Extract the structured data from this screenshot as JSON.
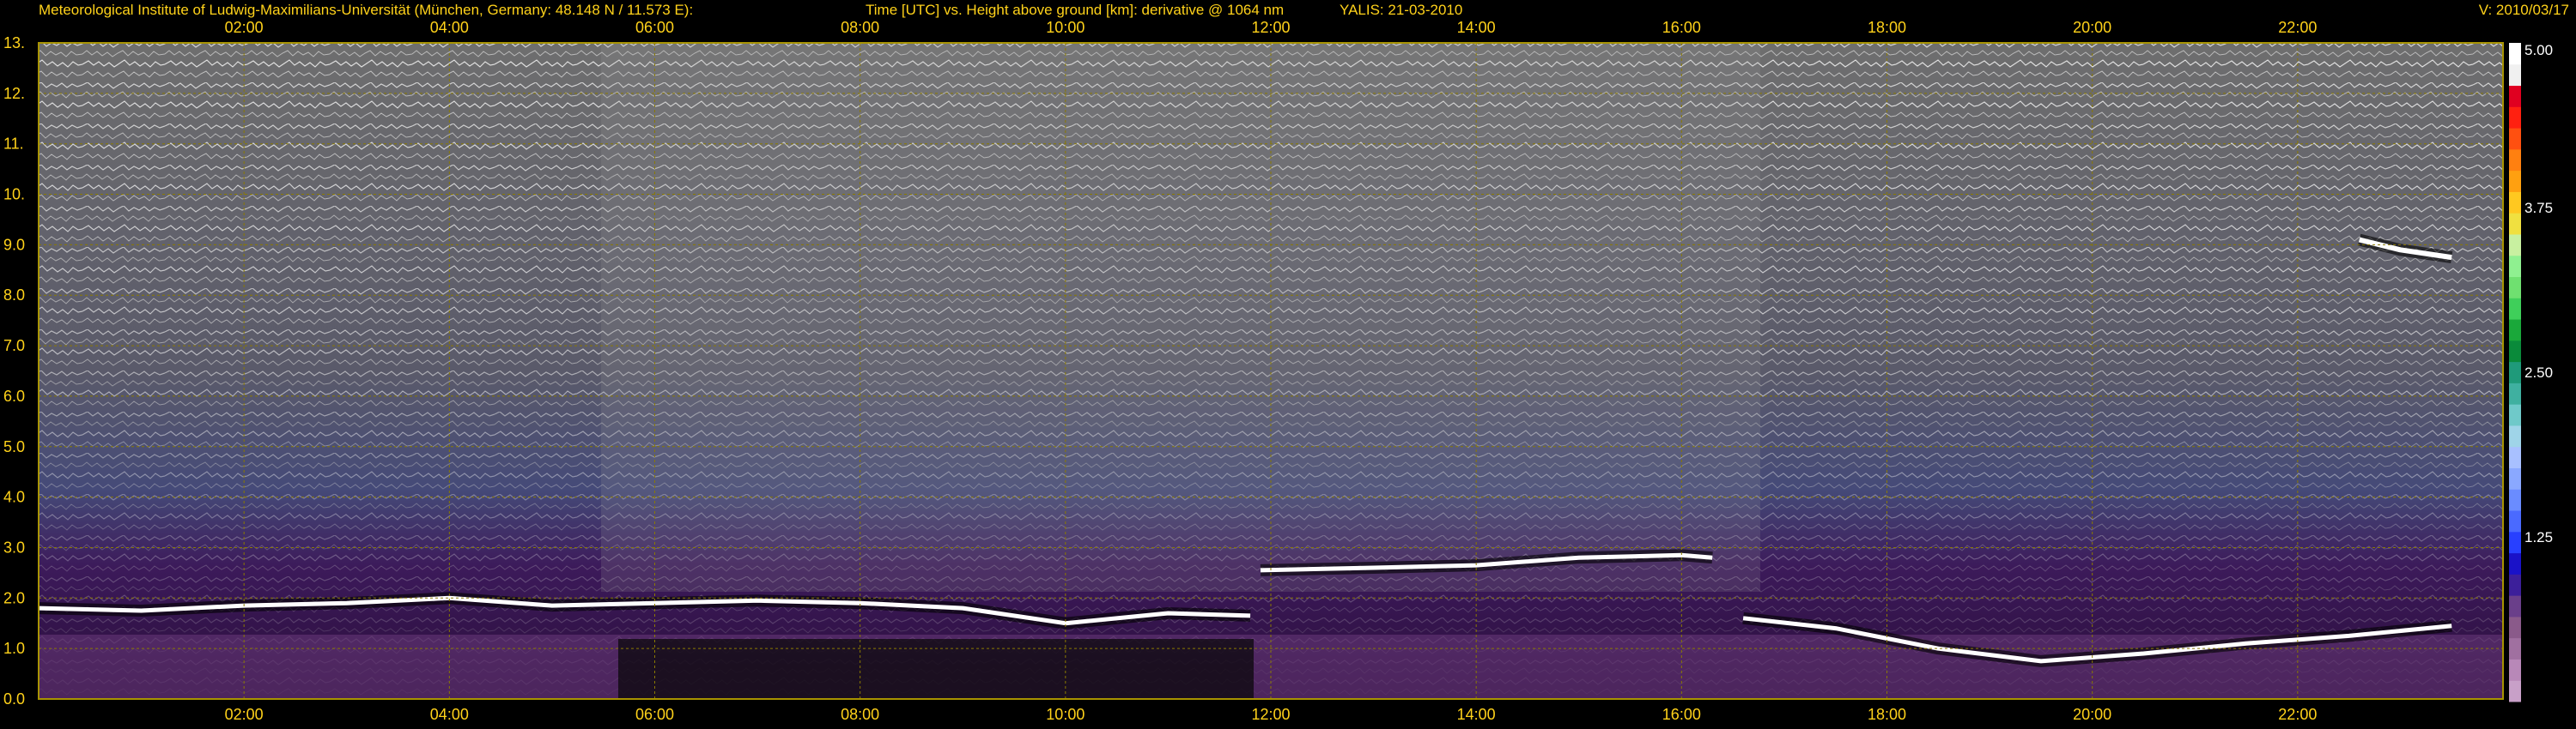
{
  "header": {
    "institute": "Meteorological Institute of Ludwig-Maximilians-Universität (München, Germany: 48.148 N / 11.573 E):",
    "description": "Time [UTC] vs. Height above ground [km]: derivative @ 1064 nm",
    "system_date": "YALIS: 21-03-2010",
    "version": "V: 2010/03/17"
  },
  "colors": {
    "background": "#000000",
    "axis_text": "#ffd21a",
    "frame": "#a89400",
    "grid": "#8a7a00"
  },
  "chart_data": {
    "type": "heatmap",
    "title": "Time [UTC] vs. Height above ground [km]: derivative @ 1064 nm",
    "xlabel": "Time [UTC]",
    "ylabel": "Height above ground [km]",
    "xlim_hours": [
      0.0,
      24.0
    ],
    "ylim_km": [
      0.0,
      13.0
    ],
    "grid": true,
    "x_ticks": [
      {
        "hour": 2,
        "label": "02:00"
      },
      {
        "hour": 4,
        "label": "04:00"
      },
      {
        "hour": 6,
        "label": "06:00"
      },
      {
        "hour": 8,
        "label": "08:00"
      },
      {
        "hour": 10,
        "label": "10:00"
      },
      {
        "hour": 12,
        "label": "12:00"
      },
      {
        "hour": 14,
        "label": "14:00"
      },
      {
        "hour": 16,
        "label": "16:00"
      },
      {
        "hour": 18,
        "label": "18:00"
      },
      {
        "hour": 20,
        "label": "20:00"
      },
      {
        "hour": 22,
        "label": "22:00"
      }
    ],
    "y_ticks": [
      {
        "km": 0,
        "label": "0.0"
      },
      {
        "km": 1,
        "label": "1.0"
      },
      {
        "km": 2,
        "label": "2.0"
      },
      {
        "km": 3,
        "label": "3.0"
      },
      {
        "km": 4,
        "label": "4.0"
      },
      {
        "km": 5,
        "label": "5.0"
      },
      {
        "km": 6,
        "label": "6.0"
      },
      {
        "km": 7,
        "label": "7.0"
      },
      {
        "km": 8,
        "label": "8.0"
      },
      {
        "km": 9,
        "label": "9.0"
      },
      {
        "km": 10,
        "label": "10."
      },
      {
        "km": 11,
        "label": "11."
      },
      {
        "km": 12,
        "label": "12."
      },
      {
        "km": 13,
        "label": "13."
      }
    ],
    "colorbar": {
      "min": 0.0,
      "max": 5.0,
      "ticks": [
        {
          "value": 1.25,
          "label": "1.25"
        },
        {
          "value": 2.5,
          "label": "2.50"
        },
        {
          "value": 3.75,
          "label": "3.75"
        },
        {
          "value": 5.0,
          "label": "5.00"
        }
      ],
      "colors": [
        "#c8a0c8",
        "#b888b8",
        "#a070a0",
        "#8a5a8a",
        "#6a3f8a",
        "#3c1f9a",
        "#1a12c8",
        "#2840ff",
        "#4a6aff",
        "#6a8cff",
        "#8aa8ff",
        "#a8c0ff",
        "#9fd4e8",
        "#6fc9c9",
        "#3fb0a0",
        "#1f9a7a",
        "#0a8a3a",
        "#1aa83a",
        "#3fcf5a",
        "#6fe070",
        "#8ff090",
        "#c8f0a0",
        "#f0e040",
        "#ffc820",
        "#ffa010",
        "#ff8010",
        "#ff5010",
        "#ff2010",
        "#e00020",
        "#f0f0f0",
        "#ffffff"
      ]
    },
    "features": [
      {
        "name": "boundary-layer-top",
        "points": [
          [
            0.0,
            1.8
          ],
          [
            1.0,
            1.75
          ],
          [
            2.0,
            1.85
          ],
          [
            3.0,
            1.9
          ],
          [
            4.0,
            2.0
          ],
          [
            5.0,
            1.85
          ],
          [
            6.0,
            1.9
          ],
          [
            7.0,
            1.95
          ],
          [
            8.0,
            1.9
          ],
          [
            9.0,
            1.8
          ],
          [
            10.0,
            1.5
          ],
          [
            11.0,
            1.7
          ],
          [
            11.8,
            1.65
          ]
        ]
      },
      {
        "name": "elevated-layer",
        "points": [
          [
            11.9,
            2.55
          ],
          [
            13.0,
            2.6
          ],
          [
            14.0,
            2.65
          ],
          [
            15.0,
            2.8
          ],
          [
            16.0,
            2.85
          ],
          [
            16.3,
            2.8
          ]
        ]
      },
      {
        "name": "evening-layer",
        "points": [
          [
            16.6,
            1.6
          ],
          [
            17.5,
            1.4
          ],
          [
            18.5,
            1.0
          ],
          [
            19.5,
            0.75
          ],
          [
            20.5,
            0.9
          ],
          [
            21.5,
            1.1
          ],
          [
            22.5,
            1.25
          ],
          [
            23.5,
            1.45
          ]
        ]
      },
      {
        "name": "cirrus",
        "points": [
          [
            22.6,
            9.1
          ],
          [
            23.0,
            8.9
          ],
          [
            23.5,
            8.75
          ]
        ]
      }
    ]
  }
}
